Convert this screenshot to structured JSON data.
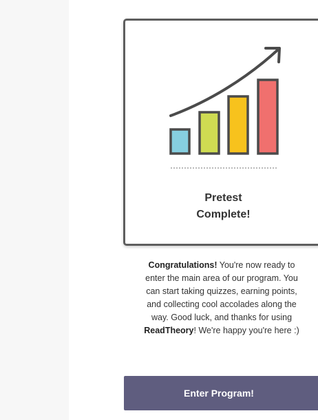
{
  "colors": {
    "bar_blue": "#86cfe0",
    "bar_green": "#cfdc52",
    "bar_orange": "#f7c21d",
    "bar_red": "#f0706e",
    "outline": "#4b4b4b",
    "button": "#5f5d7f"
  },
  "card": {
    "icon": "growth-bar-chart-icon",
    "title_line1": "Pretest",
    "title_line2": "Complete!"
  },
  "message": {
    "line1_bold": "Congratulations!",
    "line1_rest": " You're now ready to",
    "line2": "enter the main area of our program. You",
    "line3": "can start taking quizzes, earning points,",
    "line4": "and collecting cool accolades along the",
    "line5": "way. Good luck, and thanks for using",
    "line6_bold": "ReadTheory",
    "line6_rest": "! We're happy you're here :)"
  },
  "button": {
    "label": "Enter Program!"
  }
}
